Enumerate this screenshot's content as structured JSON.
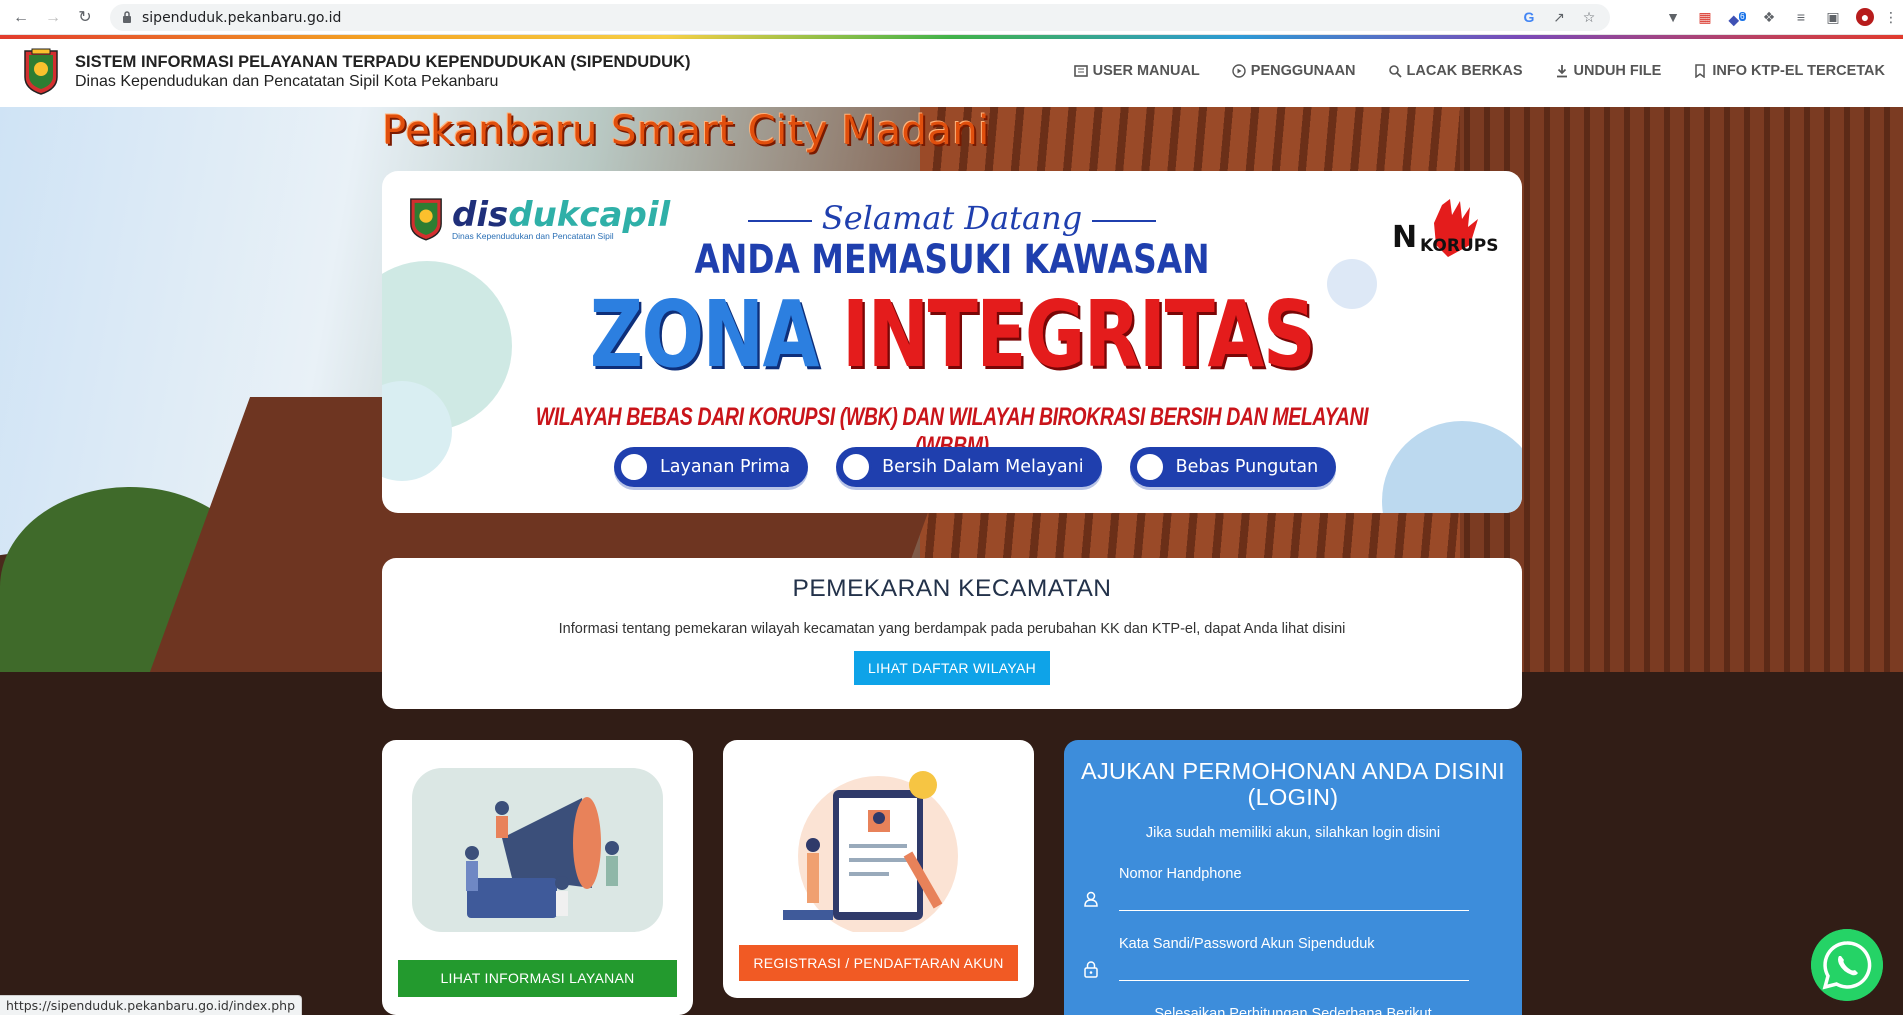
{
  "browser": {
    "url": "sipenduduk.pekanbaru.go.id",
    "status_url": "https://sipenduduk.pekanbaru.go.id/index.php",
    "extension_badge": "6"
  },
  "header": {
    "title": "SISTEM INFORMASI PELAYANAN TERPADU KEPENDUDUKAN (SIPENDUDUK)",
    "subtitle": "Dinas Kependudukan dan Pencatatan Sipil Kota Pekanbaru",
    "nav": [
      "USER MANUAL",
      "PENGGUNAAN",
      "LACAK BERKAS",
      "UNDUH FILE",
      "INFO KTP-EL TERCETAK"
    ]
  },
  "hero": {
    "title": "Pekanbaru Smart City Madani"
  },
  "banner": {
    "brand_dis": "dis",
    "brand_dukcapil": "dukcapil",
    "brand_sub": "Dinas Kependudukan dan Pencatatan Sipil",
    "welcome": "Selamat Datang",
    "line1": "ANDA MEMASUKI KAWASAN",
    "zona": "ZONA",
    "integritas": "INTEGRITAS",
    "wbk": "WILAYAH BEBAS DARI KORUPSI (WBK) DAN WILAYAH BIROKRASI BERSIH DAN MELAYANI (WBBM)",
    "pills": [
      "Layanan Prima",
      "Bersih Dalam Melayani",
      "Bebas Pungutan"
    ],
    "no_korupsi_n": "N",
    "no_korupsi_text": "KORUPSI"
  },
  "pemekaran": {
    "title": "PEMEKARAN KECAMATAN",
    "text": "Informasi tentang pemekaran wilayah kecamatan yang berdampak pada perubahan KK dan KTP-el, dapat Anda lihat disini",
    "button": "LIHAT DAFTAR WILAYAH"
  },
  "cards": {
    "info_button": "LIHAT INFORMASI LAYANAN",
    "register_button": "REGISTRASI / PENDAFTARAN AKUN"
  },
  "login": {
    "title": "AJUKAN PERMOHONAN ANDA DISINI (LOGIN)",
    "subtitle": "Jika sudah memiliki akun, silahkan login disini",
    "phone_label": "Nomor Handphone",
    "password_label": "Kata Sandi/Password Akun Sipenduduk",
    "math_label": "Selesaikan Perhitungan Sederhana Berikut"
  },
  "colors": {
    "primary_blue": "#3d8ddb",
    "button_blue": "#0ea3e8",
    "green": "#239a2e",
    "orange": "#f15a24",
    "title_orange": "#e14f0d",
    "whatsapp": "#25d366"
  }
}
